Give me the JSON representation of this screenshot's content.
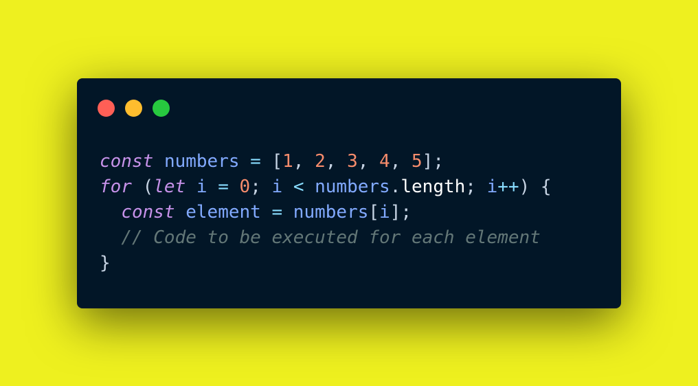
{
  "colors": {
    "background": "#eef01f",
    "window": "#021627",
    "close_dot": "#ff5f56",
    "minimize_dot": "#ffbd2e",
    "maximize_dot": "#27c93f"
  },
  "code": {
    "line1": {
      "kw": "const",
      "name": "numbers",
      "eq": "=",
      "open": "[",
      "n1": "1",
      "n2": "2",
      "n3": "3",
      "n4": "4",
      "n5": "5",
      "comma": ", ",
      "close": "];"
    },
    "line2": {
      "kw1": "for",
      "paren_open": "(",
      "kw2": "let",
      "i": "i",
      "eq": "=",
      "zero": "0",
      "semi": ";",
      "lt": "<",
      "numbers": "numbers",
      "dot": ".",
      "length": "length",
      "inc": "++",
      "paren_close": ")",
      "brace": "{"
    },
    "line3": {
      "kw": "const",
      "name": "element",
      "eq": "=",
      "numbers": "numbers",
      "open": "[",
      "i": "i",
      "close": "];"
    },
    "line4": {
      "comment": "// Code to be executed for each element"
    },
    "line5": {
      "brace": "}"
    }
  }
}
